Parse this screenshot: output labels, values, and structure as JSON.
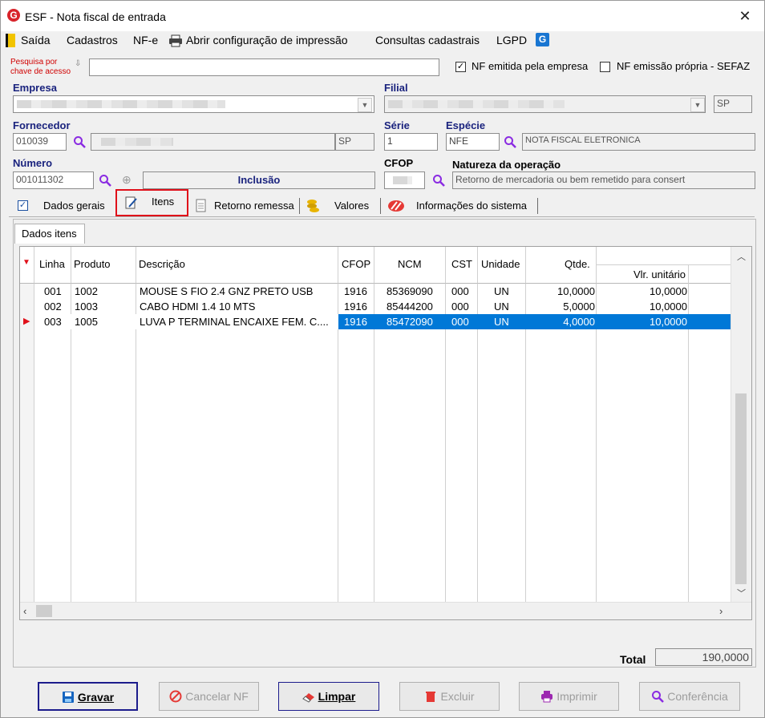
{
  "window": {
    "title": "ESF - Nota fiscal de entrada",
    "close": "✕"
  },
  "menu": {
    "saida": "Saída",
    "cadastros": "Cadastros",
    "nfe": "NF-e",
    "abrir_config": "Abrir configuração de impressão",
    "consultas": "Consultas cadastrais",
    "lgpd": "LGPD"
  },
  "search": {
    "label_line1": "Pesquisa por",
    "label_line2": "chave de acesso",
    "value": "",
    "nf_emitida_label": "NF emitida pela empresa",
    "nf_emitida_checked": true,
    "nf_propria_label": "NF emissão própria - SEFAZ",
    "nf_propria_checked": false
  },
  "form": {
    "empresa_label": "Empresa",
    "filial_label": "Filial",
    "filial_uf": "SP",
    "fornecedor_label": "Fornecedor",
    "fornecedor_code": "010039",
    "fornecedor_uf": "SP",
    "serie_label": "Série",
    "serie_value": "1",
    "especie_label": "Espécie",
    "especie_value": "NFE",
    "especie_desc": "NOTA FISCAL ELETRONICA",
    "numero_label": "Número",
    "numero_value": "001011302",
    "modo": "Inclusão",
    "cfop_label": "CFOP",
    "natureza_label": "Natureza da operação",
    "natureza_value": "Retorno de mercadoria ou bem remetido para consert"
  },
  "tabs": [
    "Dados gerais",
    "Itens",
    "Retorno remessa",
    "Valores",
    "Informações do sistema"
  ],
  "subtab": "Dados itens",
  "grid": {
    "headers": [
      "Linha",
      "Produto",
      "Descrição",
      "CFOP",
      "NCM",
      "CST",
      "Unidade",
      "Qtde.",
      "Vlr. unitário"
    ],
    "rows": [
      {
        "linha": "001",
        "produto": "1002",
        "descricao": "MOUSE S FIO 2.4 GNZ PRETO USB",
        "cfop": "1916",
        "ncm": "85369090",
        "cst": "000",
        "unidade": "UN",
        "qtde": "10,0000",
        "vlr": "10,0000"
      },
      {
        "linha": "002",
        "produto": "1003",
        "descricao": "CABO HDMI 1.4 10 MTS",
        "cfop": "1916",
        "ncm": "85444200",
        "cst": "000",
        "unidade": "UN",
        "qtde": "5,0000",
        "vlr": "10,0000"
      },
      {
        "linha": "003",
        "produto": "1005",
        "descricao": "LUVA P TERMINAL ENCAIXE FEM. C....",
        "cfop": "1916",
        "ncm": "85472090",
        "cst": "000",
        "unidade": "UN",
        "qtde": "4,0000",
        "vlr": "10,0000"
      }
    ]
  },
  "total": {
    "label": "Total",
    "value": "190,0000"
  },
  "buttons": {
    "gravar": "Gravar",
    "cancelar": "Cancelar NF",
    "limpar": "Limpar",
    "excluir": "Excluir",
    "imprimir": "Imprimir",
    "conferencia": "Conferência"
  },
  "colors": {
    "highlight": "#0078d7",
    "label_blue": "#1a237e",
    "accent_red": "#d8232a",
    "focus_box": "#e0101a"
  }
}
